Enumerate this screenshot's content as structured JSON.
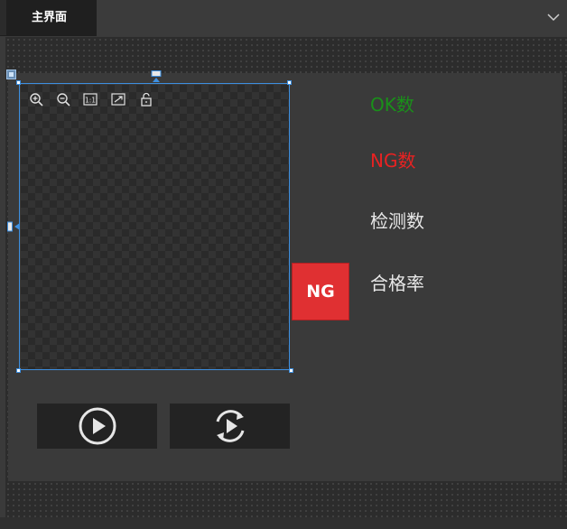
{
  "tabs": [
    {
      "label": "主界面",
      "active": true
    }
  ],
  "tools": [
    {
      "name": "zoom-in-icon"
    },
    {
      "name": "zoom-out-icon"
    },
    {
      "name": "fit-1to1-icon",
      "label": "1:1"
    },
    {
      "name": "fit-window-icon"
    },
    {
      "name": "unlock-icon"
    }
  ],
  "result": {
    "label": "NG",
    "color": "#e03032"
  },
  "stats": {
    "ok_label": "OK数",
    "ng_label": "NG数",
    "detect_label": "检测数",
    "pass_rate_label": "合格率"
  },
  "colors": {
    "ok": "#1a8f1a",
    "ng": "#e82222",
    "text": "#e8e8e8",
    "selection": "#3d8fe0"
  },
  "buttons": [
    {
      "name": "run-once-button",
      "icon": "play-circle-icon"
    },
    {
      "name": "run-loop-button",
      "icon": "loop-play-icon"
    }
  ]
}
